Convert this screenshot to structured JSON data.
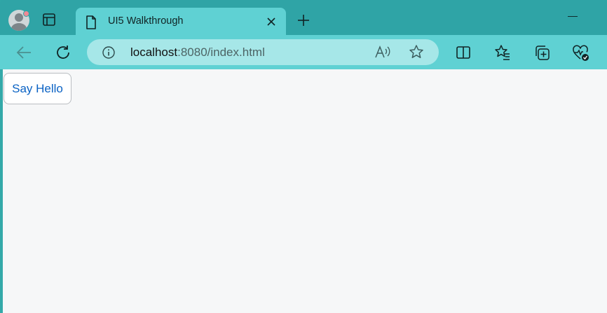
{
  "browser": {
    "tab": {
      "title": "UI5 Walkthrough",
      "favicon": "page-icon"
    },
    "address_bar": {
      "host": "localhost",
      "rest": ":8080/index.html"
    },
    "icons": {
      "back": "back-arrow-icon",
      "reload": "reload-icon",
      "info": "info-icon",
      "read_aloud": "read-aloud-icon",
      "favorite": "star-icon",
      "split": "split-screen-icon",
      "favorites": "favorites-icon",
      "collections": "collections-icon",
      "health": "browser-essentials-icon"
    },
    "colors": {
      "frame": "#2fa4a6",
      "toolbar": "#5fd1d3",
      "address": "#a6e7e8"
    }
  },
  "page": {
    "button_label": "Say Hello",
    "button_color": "#0a62c4",
    "background": "#f6f7f8"
  }
}
